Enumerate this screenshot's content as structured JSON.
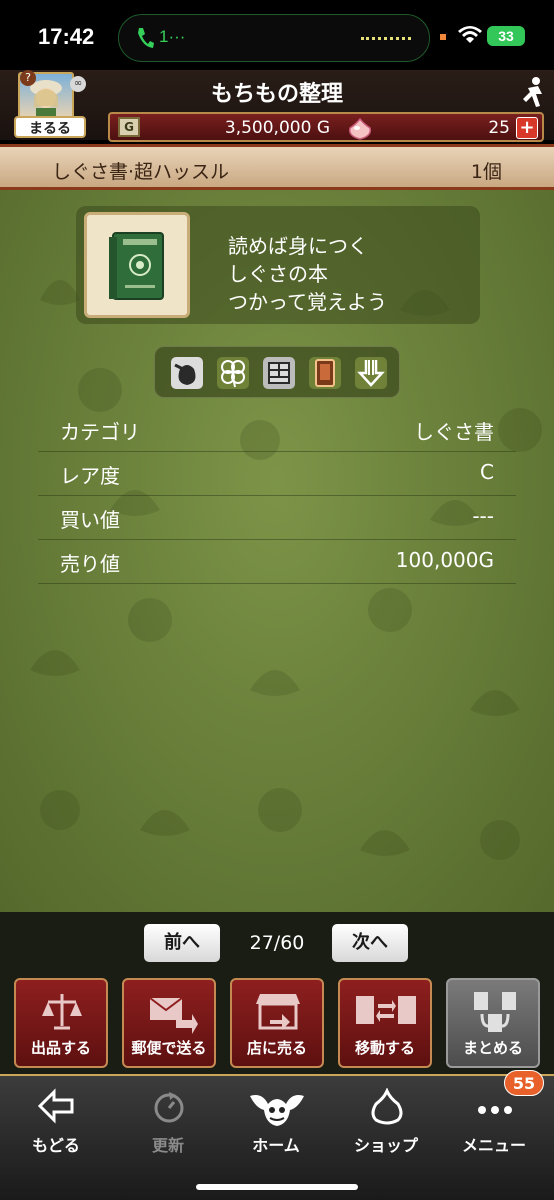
{
  "status_bar": {
    "time": "17:42",
    "call_label": "1···",
    "battery": "33"
  },
  "header": {
    "title": "もちもの整理",
    "avatar_name": "まるる",
    "avatar_badge": "?",
    "gold": "3,500,000 G",
    "gold_icon_text": "G",
    "gems": "25",
    "add_label": "+"
  },
  "item": {
    "name": "しぐさ書·超ハッスル",
    "count": "1個",
    "description": [
      "読めば身につく",
      "しぐさの本",
      "つかって覚えよう"
    ],
    "tag_icons": [
      "bag-icon",
      "clover-icon",
      "drawer-icon",
      "card-icon",
      "arrow-down-icon"
    ]
  },
  "stats": [
    {
      "label": "カテゴリ",
      "value": "しぐさ書"
    },
    {
      "label": "レア度",
      "value": "C"
    },
    {
      "label": "買い値",
      "value": "---"
    },
    {
      "label": "売り値",
      "value": "100,000G"
    }
  ],
  "pager": {
    "prev_label": "前へ",
    "indicator": "27/60",
    "next_label": "次へ"
  },
  "actions": [
    {
      "label": "出品する",
      "icon": "scales-icon"
    },
    {
      "label": "郵便で送る",
      "icon": "mail-send-icon"
    },
    {
      "label": "店に売る",
      "icon": "shop-sell-icon"
    },
    {
      "label": "移動する",
      "icon": "transfer-icon"
    },
    {
      "label": "まとめる",
      "icon": "merge-icon"
    }
  ],
  "tabbar": {
    "items": [
      {
        "label": "もどる",
        "icon": "back-arrow-icon"
      },
      {
        "label": "更新",
        "icon": "refresh-icon"
      },
      {
        "label": "ホーム",
        "icon": "home-dracky-icon"
      },
      {
        "label": "ショップ",
        "icon": "slime-shop-icon"
      },
      {
        "label": "メニュー",
        "icon": "menu-dots-icon"
      }
    ],
    "menu_badge": "55"
  },
  "colors": {
    "header_bg": "#1a1210",
    "currency_bar": "#6a1a1a",
    "main_bg": "#667c38",
    "action_red": "#7a1818",
    "badge_orange": "#e8612a"
  }
}
